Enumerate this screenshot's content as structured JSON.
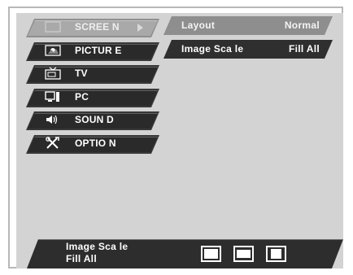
{
  "menu": {
    "items": [
      {
        "label": "SCREE N",
        "icon": "screen-icon",
        "active": true
      },
      {
        "label": "PICTUR E",
        "icon": "picture-icon",
        "active": false
      },
      {
        "label": "TV",
        "icon": "tv-icon",
        "active": false
      },
      {
        "label": "PC",
        "icon": "pc-icon",
        "active": false
      },
      {
        "label": "SOUN D",
        "icon": "sound-icon",
        "active": false
      },
      {
        "label": "OPTIO N",
        "icon": "tools-icon",
        "active": false
      }
    ]
  },
  "submenu": {
    "rows": [
      {
        "label": "Layout",
        "value": "Normal"
      },
      {
        "label": "Image Sca le",
        "value": "Fill All"
      }
    ]
  },
  "status": {
    "title": "Image Sca le",
    "value": "Fill All",
    "scale_icons": [
      "fill-all-icon",
      "normal-icon",
      "full-screen-icon"
    ]
  },
  "colors": {
    "background": "#d3d3d3",
    "menu_dark": "#2a2a2a",
    "menu_active": "#a9a9a9",
    "submenu_highlight": "#8e8e8e"
  }
}
